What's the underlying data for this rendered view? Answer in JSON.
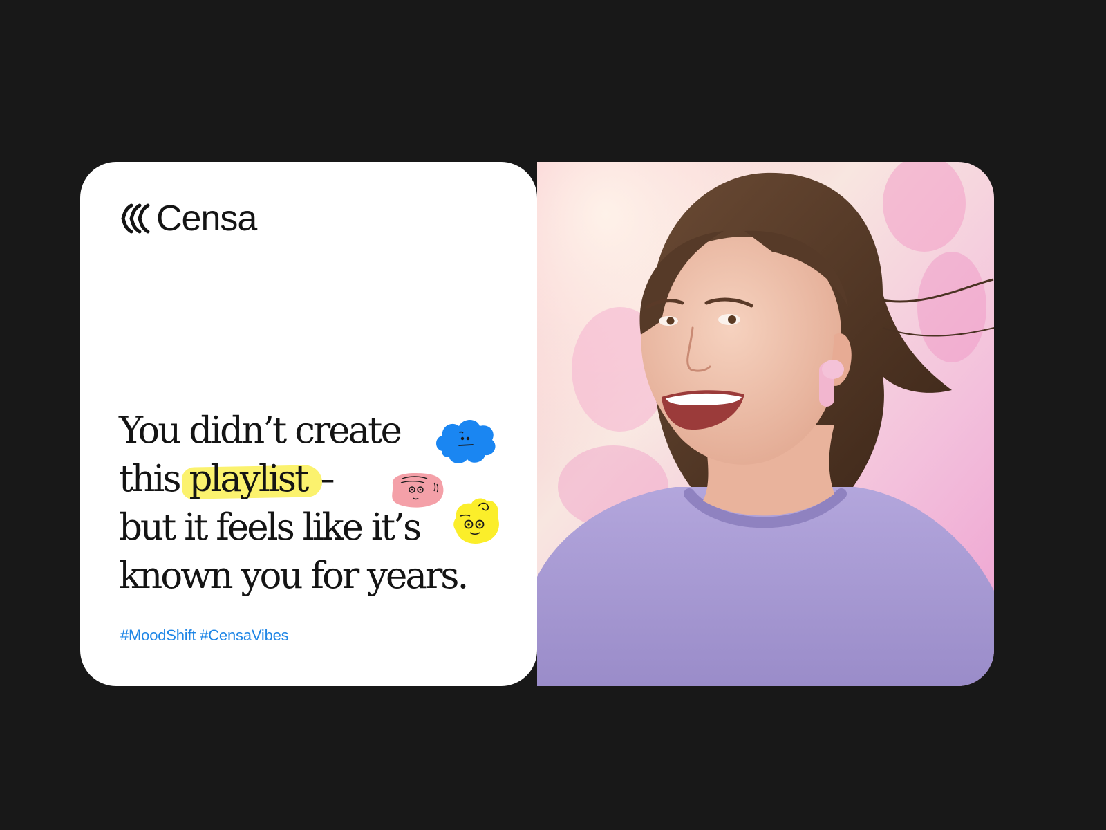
{
  "brand": {
    "name": "Censa",
    "logo_icon": "censa-chevron-waves-icon"
  },
  "headline": {
    "line1": "You didn’t create",
    "line2_before": "this",
    "line2_highlight": "playlist",
    "line2_after": "–",
    "line3": "but it feels like it’s",
    "line4": "known you for years."
  },
  "hashtags": "#MoodShift #CensaVibes",
  "stickers": [
    "blue-cloud-face-icon",
    "pink-blob-face-icon",
    "yellow-blob-face-icon"
  ],
  "photo": {
    "subject": "smiling-woman-with-earbud-photo"
  },
  "colors": {
    "background": "#181818",
    "card": "#ffffff",
    "text": "#141414",
    "hashtag": "#1f86e6",
    "highlight": "#fbf26e",
    "sticker_blue": "#1a86f2",
    "sticker_pink": "#f4a0a8",
    "sticker_yellow": "#fbee2a",
    "sweater": "#a89ad4"
  }
}
